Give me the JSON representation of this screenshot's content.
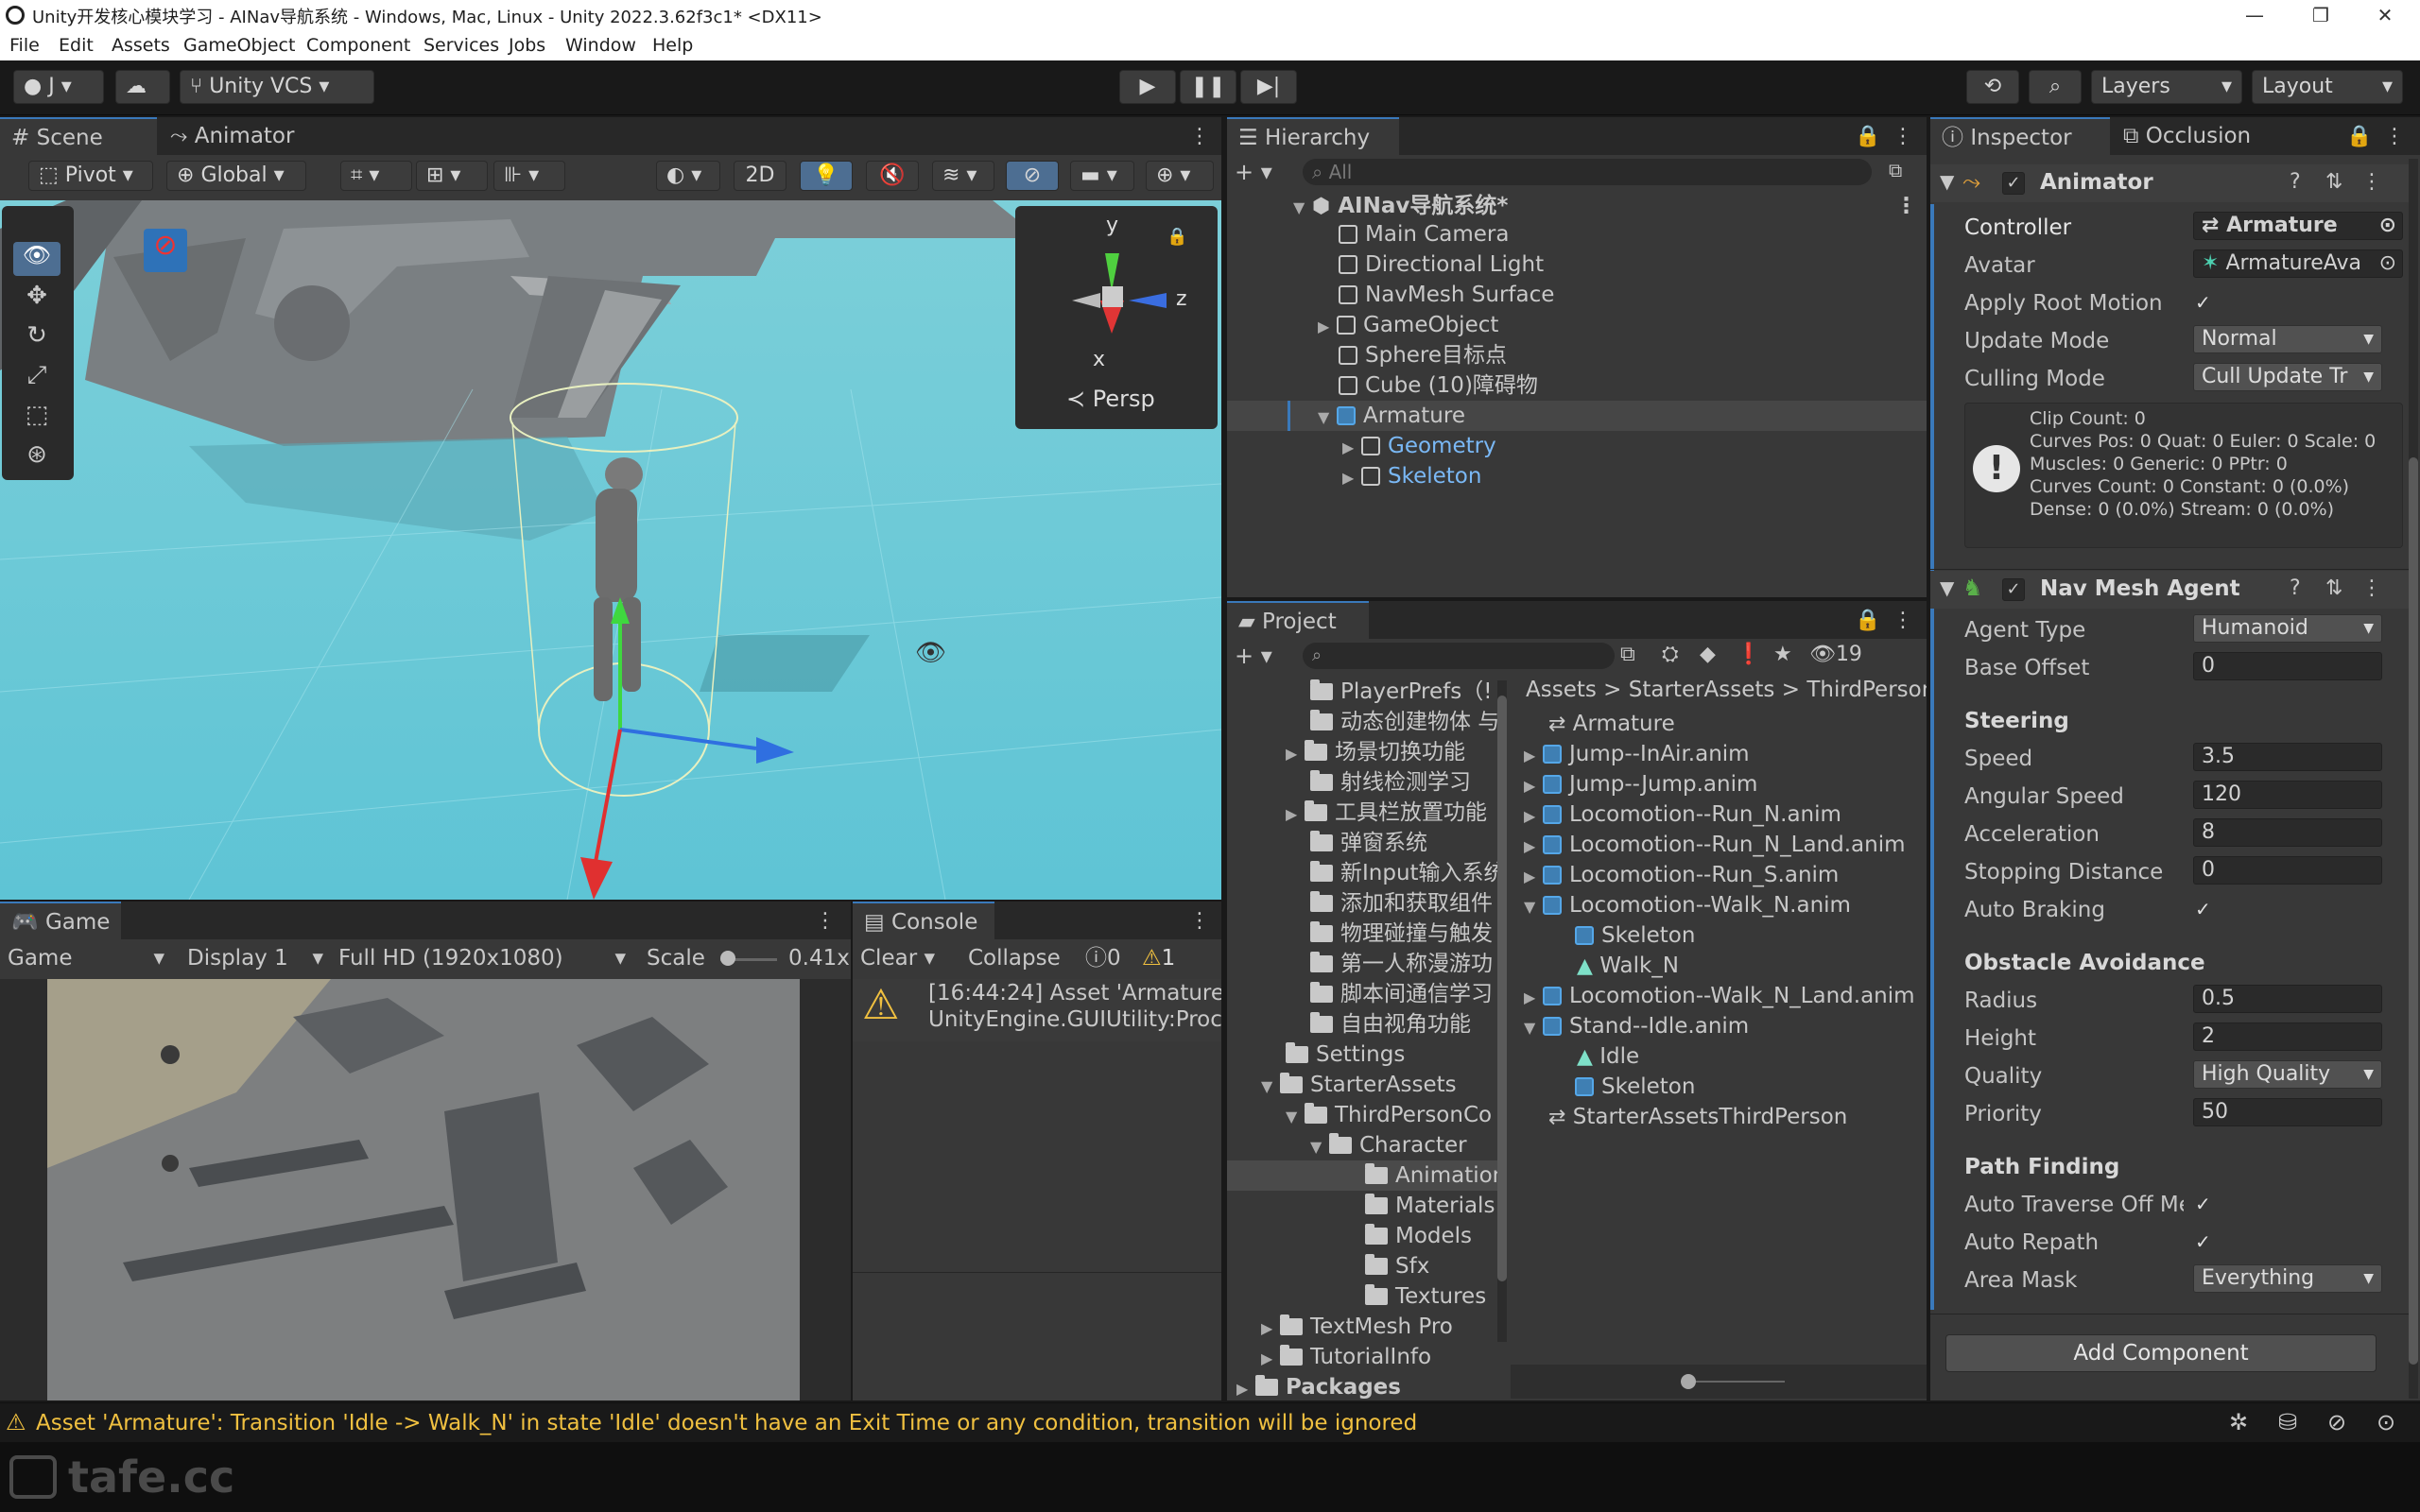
{
  "window": {
    "title": "Unity开发核心模块学习 - AINav导航系统 - Windows, Mac, Linux - Unity 2022.3.62f3c1* <DX11>",
    "min": "—",
    "max": "❐",
    "close": "✕"
  },
  "menu": [
    "File",
    "Edit",
    "Assets",
    "GameObject",
    "Component",
    "Services",
    "Jobs",
    "Window",
    "Help"
  ],
  "toolbar": {
    "account": "J",
    "vcs": "Unity VCS",
    "layers": "Layers",
    "layout": "Layout"
  },
  "scene": {
    "tabs": [
      "Scene",
      "Animator"
    ],
    "pivot": "Pivot",
    "global": "Global",
    "mode2d": "2D",
    "gizmo": {
      "y": "y",
      "z": "z",
      "x": "x",
      "persp": "Persp"
    }
  },
  "game": {
    "tab": "Game",
    "mode": "Game",
    "display": "Display 1",
    "res": "Full HD (1920x1080)",
    "scale_label": "Scale",
    "scale": "0.41x"
  },
  "console": {
    "tab": "Console",
    "clear": "Clear",
    "collapse": "Collapse",
    "count_info": "0",
    "count_warn": "1",
    "line1": "[16:44:24] Asset 'Armature':",
    "line2": "UnityEngine.GUIUtility:Proc"
  },
  "hierarchy": {
    "tab": "Hierarchy",
    "search": "All",
    "items": [
      {
        "label": "AINav导航系统*"
      },
      {
        "label": "Main Camera"
      },
      {
        "label": "Directional Light"
      },
      {
        "label": "NavMesh Surface"
      },
      {
        "label": "GameObject"
      },
      {
        "label": "Sphere目标点"
      },
      {
        "label": "Cube (10)障碍物"
      },
      {
        "label": "Armature"
      },
      {
        "label": "Geometry"
      },
      {
        "label": "Skeleton"
      }
    ]
  },
  "project": {
    "tab": "Project",
    "count": "19",
    "breadcrumb": [
      "Assets",
      "StarterAssets",
      "ThirdPerson"
    ],
    "tree": [
      "PlayerPrefs（!",
      "动态创建物体 与",
      "场景切换功能",
      "射线检测学习",
      "工具栏放置功能",
      "弹窗系统",
      "新Input输入系统",
      "添加和获取组件",
      "物理碰撞与触发",
      "第一人称漫游功",
      "脚本间通信学习",
      "自由视角功能",
      "Settings",
      "StarterAssets",
      "ThirdPersonCo",
      "Character",
      "Animation",
      "Materials",
      "Models",
      "Sfx",
      "Textures",
      "TextMesh Pro",
      "TutorialInfo",
      "Packages"
    ],
    "files": [
      "Armature",
      "Jump--InAir.anim",
      "Jump--Jump.anim",
      "Locomotion--Run_N.anim",
      "Locomotion--Run_N_Land.anim",
      "Locomotion--Run_S.anim",
      "Locomotion--Walk_N.anim",
      "Skeleton",
      "Walk_N",
      "Locomotion--Walk_N_Land.anim",
      "Stand--Idle.anim",
      "Idle",
      "Skeleton",
      "StarterAssetsThirdPerson"
    ]
  },
  "inspector": {
    "tabs": [
      "Inspector",
      "Occlusion"
    ],
    "animator": {
      "title": "Animator",
      "controller_label": "Controller",
      "controller": "Armature",
      "avatar_label": "Avatar",
      "avatar": "ArmatureAva",
      "root_motion": "Apply Root Motion",
      "update_label": "Update Mode",
      "update": "Normal",
      "culling_label": "Culling Mode",
      "culling": "Cull Update Tr",
      "info": [
        "Clip Count: 0",
        "Curves Pos: 0 Quat: 0 Euler: 0 Scale: 0",
        "Muscles: 0 Generic: 0 PPtr: 0",
        "Curves Count: 0 Constant: 0 (0.0%)",
        "Dense: 0 (0.0%) Stream: 0 (0.0%)"
      ]
    },
    "nav": {
      "title": "Nav Mesh Agent",
      "agent_type_label": "Agent Type",
      "agent_type": "Humanoid",
      "base_offset_label": "Base Offset",
      "base_offset": "0",
      "steering": "Steering",
      "speed_label": "Speed",
      "speed": "3.5",
      "angular_label": "Angular Speed",
      "angular": "120",
      "accel_label": "Acceleration",
      "accel": "8",
      "stop_label": "Stopping Distance",
      "stop": "0",
      "braking_label": "Auto Braking",
      "obstacle": "Obstacle Avoidance",
      "radius_label": "Radius",
      "radius": "0.5",
      "height_label": "Height",
      "height": "2",
      "quality_label": "Quality",
      "quality": "High Quality",
      "priority_label": "Priority",
      "priority": "50",
      "pathfinding": "Path Finding",
      "traverse_label": "Auto Traverse Off Me",
      "repath_label": "Auto Repath",
      "area_label": "Area Mask",
      "area": "Everything"
    },
    "add": "Add Component"
  },
  "status": {
    "message": "Asset 'Armature': Transition 'Idle -> Walk_N' in state 'Idle' doesn't have an Exit Time or any condition, transition will be ignored"
  },
  "watermark": "tafe.cc"
}
